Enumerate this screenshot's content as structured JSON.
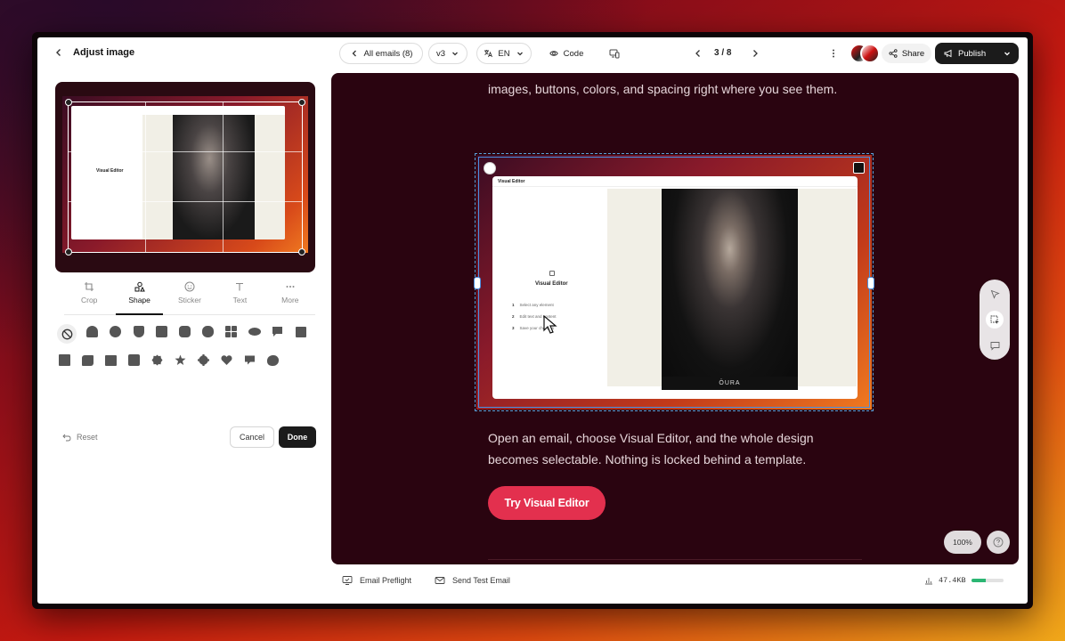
{
  "header": {
    "back_label": "Adjust image",
    "all_emails": "All emails (8)",
    "version": "v3",
    "language": "EN",
    "code_label": "Code",
    "pager": "3 / 8",
    "share_label": "Share",
    "publish_label": "Publish"
  },
  "thumbnail": {
    "title": "Visual Editor"
  },
  "tools": [
    {
      "label": "Crop",
      "icon": "crop-icon"
    },
    {
      "label": "Shape",
      "icon": "shape-icon"
    },
    {
      "label": "Sticker",
      "icon": "sticker-icon"
    },
    {
      "label": "Text",
      "icon": "text-icon"
    },
    {
      "label": "More",
      "icon": "more-icon"
    }
  ],
  "shape_panel": {
    "reset_label": "Reset",
    "cancel_label": "Cancel",
    "done_label": "Done"
  },
  "canvas": {
    "para_top": "images, buttons, colors, and spacing right where you see them.",
    "para_bottom": "Open an email, choose Visual Editor, and the whole design becomes selectable. Nothing is locked behind a template.",
    "cta_label": "Try Visual Editor",
    "zoom_label": "100%"
  },
  "embedded_screen": {
    "title": "Visual Editor",
    "heading": "Visual Editor",
    "steps": [
      {
        "num": "1",
        "text": "Select any element"
      },
      {
        "num": "2",
        "text": "Edit text and content"
      },
      {
        "num": "3",
        "text": "Save your changes"
      }
    ],
    "photo_caption": "ÖURA"
  },
  "footer": {
    "preflight_label": "Email Preflight",
    "test_label": "Send Test Email",
    "size_label": "47.4KB",
    "size_progress": 0.45
  },
  "colors": {
    "accent": "#e3304e",
    "canvas_bg": "#2a0410",
    "publish_bg": "#1b1b1b"
  }
}
